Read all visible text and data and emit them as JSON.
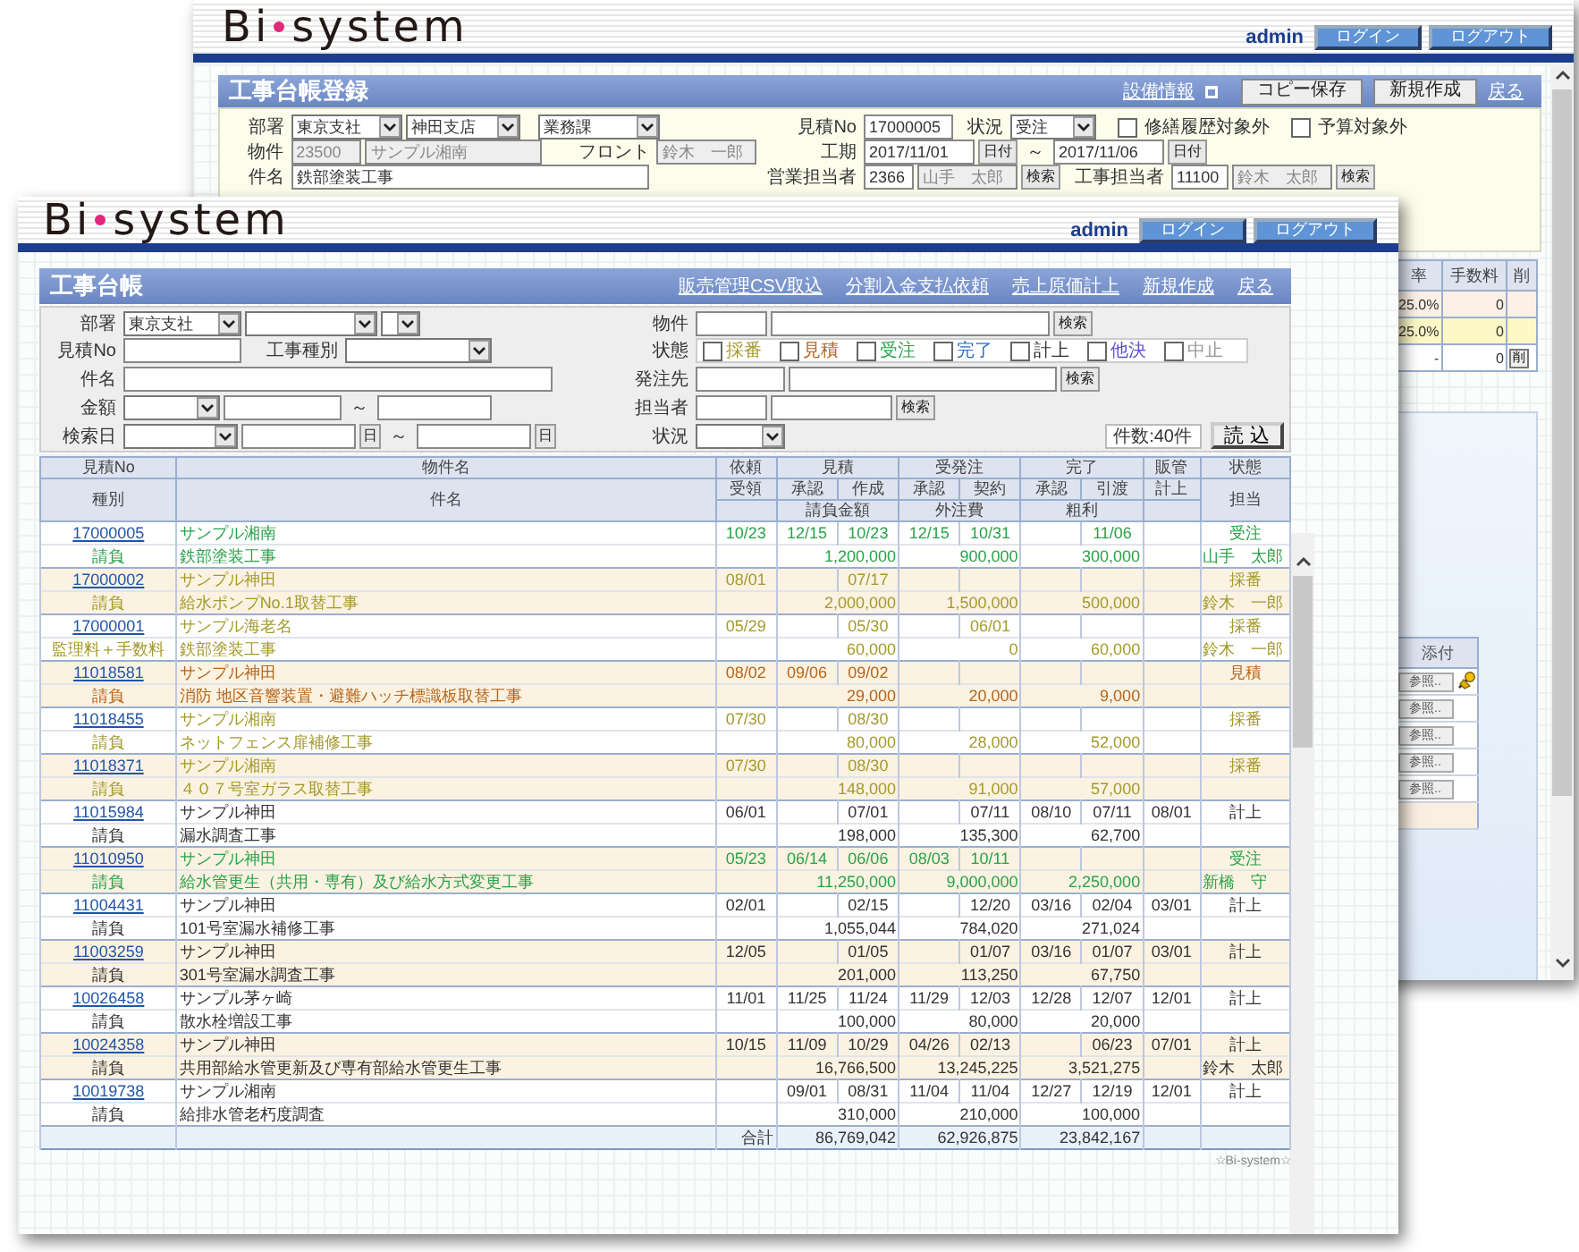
{
  "back_window": {
    "header": {
      "logo": [
        "Bi",
        "system"
      ],
      "user": "admin",
      "buttons": [
        "ログイン",
        "ログアウト"
      ]
    },
    "title": "工事台帳登録",
    "actions": [
      {
        "kind": "external_link",
        "label": "設備情報"
      },
      {
        "kind": "button",
        "label": "コピー保存"
      },
      {
        "kind": "button",
        "label": "新規作成"
      },
      {
        "kind": "link",
        "label": "戻る"
      }
    ],
    "form": {
      "department": {
        "label": "部署",
        "values": [
          "東京支社",
          "神田支店",
          "業務課"
        ]
      },
      "property": {
        "label": "物件",
        "code": "23500",
        "name": "サンプル湘南",
        "readonly": true
      },
      "front": {
        "label": "フロント",
        "value": "鈴木　一郎",
        "readonly": true
      },
      "subject": {
        "label": "件名",
        "value": "鉄部塗装工事"
      },
      "estimate_no": {
        "label": "見積No",
        "value": "17000005"
      },
      "situation": {
        "label": "状況",
        "value": "受注"
      },
      "flags": [
        {
          "label": "修繕履歴対象外",
          "checked": false
        },
        {
          "label": "予算対象外",
          "checked": false
        }
      ],
      "period": {
        "label": "工期",
        "from": "2017/11/01",
        "to": "2017/11/06",
        "separator": "～",
        "date_buttons": [
          "日付",
          "日付"
        ]
      },
      "sales_person": {
        "label": "営業担当者",
        "code": "2366",
        "name": "山手　太郎",
        "button": "検索",
        "readonly": true
      },
      "construction_person": {
        "label": "工事担当者",
        "code": "11100",
        "name": "鈴木　太郎",
        "button": "検索",
        "readonly": true
      }
    },
    "fee_table": {
      "columns": [
        "率",
        "手数料",
        "削"
      ],
      "rows": [
        {
          "rate": "25.0%",
          "fee": "0"
        },
        {
          "rate": "25.0%",
          "fee": "0"
        },
        {
          "rate": "-",
          "fee": "0",
          "delete_button": "削"
        }
      ]
    },
    "attachments": {
      "column": "添付",
      "browse_buttons": [
        "参照..",
        "参照..",
        "参照..",
        "参照..",
        "参照.."
      ]
    }
  },
  "front_window": {
    "header": {
      "logo": [
        "Bi",
        "system"
      ],
      "user": "admin",
      "buttons": [
        "ログイン",
        "ログアウト"
      ]
    },
    "title": "工事台帳",
    "links": [
      "販売管理CSV取込",
      "分割入金支払依頼",
      "売上原価計上",
      "新規作成",
      "戻る"
    ],
    "filter": {
      "department": {
        "label": "部署",
        "value": "東京支社"
      },
      "estimate_no": {
        "label": "見積No"
      },
      "work_type": {
        "label": "工事種別"
      },
      "subject": {
        "label": "件名"
      },
      "amount": {
        "label": "金額",
        "separator": "～"
      },
      "search_date": {
        "label": "検索日",
        "separator": "～",
        "date_buttons": [
          "日",
          "日"
        ]
      },
      "property": {
        "label": "物件",
        "button": "検索"
      },
      "status": {
        "label": "状態",
        "options": [
          {
            "label": "採番",
            "checked": false,
            "color": "#a49a2c"
          },
          {
            "label": "見積",
            "checked": false,
            "color": "#b5651d"
          },
          {
            "label": "受注",
            "checked": false,
            "color": "#2aa24a"
          },
          {
            "label": "完了",
            "checked": false,
            "color": "#2a6cc8"
          },
          {
            "label": "計上",
            "checked": false,
            "color": "#333333"
          },
          {
            "label": "他決",
            "checked": false,
            "color": "#5a4fcf"
          },
          {
            "label": "中止",
            "checked": false,
            "color": "#999999"
          }
        ]
      },
      "supplier": {
        "label": "発注先",
        "button": "検索"
      },
      "person": {
        "label": "担当者",
        "button": "検索"
      },
      "situation": {
        "label": "状況"
      },
      "count": "件数:40件",
      "load_button": "読 込"
    },
    "table": {
      "header": {
        "row_1": [
          "見積No",
          "物件名",
          "依頼",
          "見積",
          "受発注",
          "完了",
          "販管",
          "状態"
        ],
        "row_2": [
          "種別",
          "件名",
          "受領",
          "承認",
          "作成",
          "承認",
          "契約",
          "承認",
          "引渡",
          "計上",
          "担当"
        ],
        "row_3": [
          "請負金額",
          "外注費",
          "粗利"
        ]
      },
      "records": [
        {
          "no": "17000005",
          "property": "サンプル湘南",
          "requested": "10/23",
          "estimate_approved": "12/15",
          "estimate_created": "10/23",
          "order_approved": "12/15",
          "contracted": "10/31",
          "delivered": "11/06",
          "status": "受注",
          "color": "#2aa24a",
          "type": "請負",
          "subject": "鉄部塗装工事",
          "contract_amount": "1,200,000",
          "outsourcing_cost": "900,000",
          "gross_profit": "300,000",
          "person": "山手　太郎"
        },
        {
          "no": "17000002",
          "property": "サンプル神田",
          "requested": "08/01",
          "estimate_created": "07/17",
          "status": "採番",
          "color": "#a49a2c",
          "type": "請負",
          "subject": "給水ポンプNo.1取替工事",
          "contract_amount": "2,000,000",
          "outsourcing_cost": "1,500,000",
          "gross_profit": "500,000",
          "person": "鈴木　一郎"
        },
        {
          "no": "17000001",
          "property": "サンプル海老名",
          "requested": "05/29",
          "estimate_created": "05/30",
          "contracted": "06/01",
          "status": "採番",
          "color": "#a49a2c",
          "type": "監理料＋手数料",
          "subject": "鉄部塗装工事",
          "contract_amount": "60,000",
          "outsourcing_cost": "0",
          "gross_profit": "60,000",
          "person": "鈴木　一郎"
        },
        {
          "no": "11018581",
          "property": "サンプル神田",
          "requested": "08/02",
          "estimate_approved": "09/06",
          "estimate_created": "09/02",
          "status": "見積",
          "color": "#b5651d",
          "type": "請負",
          "subject": "消防 地区音響装置・避難ハッチ標識板取替工事",
          "contract_amount": "29,000",
          "outsourcing_cost": "20,000",
          "gross_profit": "9,000"
        },
        {
          "no": "11018455",
          "property": "サンプル湘南",
          "requested": "07/30",
          "estimate_created": "08/30",
          "status": "採番",
          "color": "#a49a2c",
          "type": "請負",
          "subject": "ネットフェンス扉補修工事",
          "contract_amount": "80,000",
          "outsourcing_cost": "28,000",
          "gross_profit": "52,000"
        },
        {
          "no": "11018371",
          "property": "サンプル湘南",
          "requested": "07/30",
          "estimate_created": "08/30",
          "status": "採番",
          "color": "#a49a2c",
          "type": "請負",
          "subject": "４０７号室ガラス取替工事",
          "contract_amount": "148,000",
          "outsourcing_cost": "91,000",
          "gross_profit": "57,000"
        },
        {
          "no": "11015984",
          "property": "サンプル神田",
          "requested": "06/01",
          "estimate_created": "07/01",
          "contracted": "07/11",
          "completion_approved": "08/10",
          "delivered": "07/11",
          "booked": "08/01",
          "status": "計上",
          "color": "#333333",
          "type": "請負",
          "subject": "漏水調査工事",
          "contract_amount": "198,000",
          "outsourcing_cost": "135,300",
          "gross_profit": "62,700"
        },
        {
          "no": "11010950",
          "property": "サンプル神田",
          "requested": "05/23",
          "estimate_approved": "06/14",
          "estimate_created": "06/06",
          "order_approved": "08/03",
          "contracted": "10/11",
          "status": "受注",
          "color": "#2aa24a",
          "type": "請負",
          "subject": "給水管更生（共用・専有）及び給水方式変更工事",
          "contract_amount": "11,250,000",
          "outsourcing_cost": "9,000,000",
          "gross_profit": "2,250,000",
          "person": "新橋　守"
        },
        {
          "no": "11004431",
          "property": "サンプル神田",
          "requested": "02/01",
          "estimate_created": "02/15",
          "contracted": "12/20",
          "completion_approved": "03/16",
          "delivered": "02/04",
          "booked": "03/01",
          "status": "計上",
          "color": "#333333",
          "type": "請負",
          "subject": "101号室漏水補修工事",
          "contract_amount": "1,055,044",
          "outsourcing_cost": "784,020",
          "gross_profit": "271,024"
        },
        {
          "no": "11003259",
          "property": "サンプル神田",
          "requested": "12/05",
          "estimate_created": "01/05",
          "contracted": "01/07",
          "completion_approved": "03/16",
          "delivered": "01/07",
          "booked": "03/01",
          "status": "計上",
          "color": "#333333",
          "type": "請負",
          "subject": "301号室漏水調査工事",
          "contract_amount": "201,000",
          "outsourcing_cost": "113,250",
          "gross_profit": "67,750"
        },
        {
          "no": "10026458",
          "property": "サンプル茅ヶ崎",
          "requested": "11/01",
          "estimate_approved": "11/25",
          "estimate_created": "11/24",
          "order_approved": "11/29",
          "contracted": "12/03",
          "completion_approved": "12/28",
          "delivered": "12/07",
          "booked": "12/01",
          "status": "計上",
          "color": "#333333",
          "type": "請負",
          "subject": "散水栓増設工事",
          "contract_amount": "100,000",
          "outsourcing_cost": "80,000",
          "gross_profit": "20,000"
        },
        {
          "no": "10024358",
          "property": "サンプル神田",
          "requested": "10/15",
          "estimate_approved": "11/09",
          "estimate_created": "10/29",
          "order_approved": "04/26",
          "contracted": "02/13",
          "delivered": "06/23",
          "booked": "07/01",
          "status": "計上",
          "color": "#333333",
          "type": "請負",
          "subject": "共用部給水管更新及び専有部給水管更生工事",
          "contract_amount": "16,766,500",
          "outsourcing_cost": "13,245,225",
          "gross_profit": "3,521,275",
          "person": "鈴木　太郎"
        },
        {
          "no": "10019738",
          "property": "サンプル湘南",
          "estimate_approved": "09/01",
          "estimate_created": "08/31",
          "order_approved": "11/04",
          "contracted": "11/04",
          "completion_approved": "12/27",
          "delivered": "12/19",
          "booked": "12/01",
          "status": "計上",
          "color": "#333333",
          "type": "請負",
          "subject": "給排水管老朽度調査",
          "contract_amount": "310,000",
          "outsourcing_cost": "210,000",
          "gross_profit": "100,000"
        }
      ],
      "total": {
        "label": "合計",
        "contract_amount": "86,769,042",
        "outsourcing_cost": "62,926,875",
        "gross_profit": "23,842,167"
      }
    },
    "footer": "☆Bi-system☆"
  }
}
